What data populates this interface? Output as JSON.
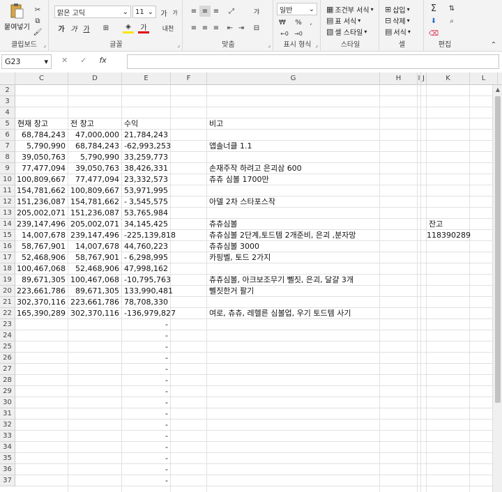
{
  "ribbon": {
    "clipboard": {
      "paste_label": "붙여넣기",
      "group_label": "클립보드"
    },
    "font": {
      "font_name": "맑은 고딕",
      "font_size": "11",
      "grow_label": "가",
      "shrink_label": "가",
      "bold_label": "가",
      "italic_label": "가",
      "underline_label": "가",
      "font_color_label": "가",
      "phonetic_label": "내천",
      "group_label": "글꼴"
    },
    "alignment": {
      "wrap_label": "갸",
      "group_label": "맞춤"
    },
    "number": {
      "format": "일반",
      "group_label": "표시 형식"
    },
    "styles": {
      "conditional_label": "조건부 서식",
      "table_label": "표 서식",
      "cell_style_label": "셀 스타일",
      "group_label": "스타일"
    },
    "cells": {
      "insert_label": "삽입",
      "delete_label": "삭제",
      "format_label": "서식",
      "group_label": "셀"
    },
    "editing": {
      "group_label": "편집"
    }
  },
  "formula_bar": {
    "name_box": "G23",
    "fx_label": "fx",
    "formula": ""
  },
  "columns": [
    "C",
    "D",
    "E",
    "F",
    "G",
    "H",
    "I",
    "J",
    "K",
    "L"
  ],
  "row_numbers": [
    "2",
    "3",
    "4",
    "5",
    "6",
    "7",
    "8",
    "9",
    "10",
    "11",
    "12",
    "13",
    "14",
    "15",
    "16",
    "17",
    "18",
    "19",
    "20",
    "21",
    "22",
    "23",
    "24",
    "25",
    "26",
    "27",
    "28",
    "29",
    "30",
    "31",
    "32",
    "33",
    "34",
    "35",
    "36",
    "37"
  ],
  "headers": {
    "current": "현재 창고",
    "previous": "전 창고",
    "profit": "수익",
    "notes": "비고",
    "balance": "잔고"
  },
  "balance_value": "118390289",
  "rows": [
    {
      "r": "6",
      "c": "68,784,243",
      "d": "47,000,000",
      "e_sign": "",
      "e": "21,784,243",
      "g": ""
    },
    {
      "r": "7",
      "c": "5,790,990",
      "d": "68,784,243",
      "e_sign": "-",
      "e": "62,993,253",
      "g": "앱솔너클 1.1"
    },
    {
      "r": "8",
      "c": "39,050,763",
      "d": "5,790,990",
      "e_sign": "",
      "e": "33,259,773",
      "g": ""
    },
    {
      "r": "9",
      "c": "77,477,094",
      "d": "39,050,763",
      "e_sign": "",
      "e": "38,426,331",
      "g": "손재주작 하려고 은괴삼 600"
    },
    {
      "r": "10",
      "c": "100,809,667",
      "d": "77,477,094",
      "e_sign": "",
      "e": "23,332,573",
      "g": "츄츄 심볼 1700만"
    },
    {
      "r": "11",
      "c": "154,781,662",
      "d": "100,809,667",
      "e_sign": "",
      "e": "53,971,995",
      "g": ""
    },
    {
      "r": "12",
      "c": "151,236,087",
      "d": "154,781,662",
      "e_sign": "-",
      "e": "3,545,575",
      "g": "아델 2차 스타포스작"
    },
    {
      "r": "13",
      "c": "205,002,071",
      "d": "151,236,087",
      "e_sign": "",
      "e": "53,765,984",
      "g": ""
    },
    {
      "r": "14",
      "c": "239,147,496",
      "d": "205,002,071",
      "e_sign": "",
      "e": "34,145,425",
      "g": "츄츄심볼"
    },
    {
      "r": "15",
      "c": "14,007,678",
      "d": "239,147,496",
      "e_sign": "-",
      "e": "225,139,818",
      "g": "츄츄심볼 2단계,토드템 2개준비, 은괴 ,분자망"
    },
    {
      "r": "16",
      "c": "58,767,901",
      "d": "14,007,678",
      "e_sign": "",
      "e": "44,760,223",
      "g": "츄츄심볼 3000"
    },
    {
      "r": "17",
      "c": "52,468,906",
      "d": "58,767,901",
      "e_sign": "-",
      "e": "6,298,995",
      "g": "카핑벨, 토드 2가지"
    },
    {
      "r": "18",
      "c": "100,467,068",
      "d": "52,468,906",
      "e_sign": "",
      "e": "47,998,162",
      "g": ""
    },
    {
      "r": "19",
      "c": "89,671,305",
      "d": "100,467,068",
      "e_sign": "-",
      "e": "10,795,763",
      "g": "츄츄심볼, 아크보조무기 뻴짓, 은괴, 달걀 3개"
    },
    {
      "r": "20",
      "c": "223,661,786",
      "d": "89,671,305",
      "e_sign": "",
      "e": "133,990,481",
      "g": "뻴짓한거 팔기"
    },
    {
      "r": "21",
      "c": "302,370,116",
      "d": "223,661,786",
      "e_sign": "",
      "e": "78,708,330",
      "g": ""
    },
    {
      "r": "22",
      "c": "165,390,289",
      "d": "302,370,116",
      "e_sign": "-",
      "e": "136,979,827",
      "g": "여로, 츄츄, 레헬른 심볼업, 우기 토드템 사기"
    }
  ],
  "dash_value": "-"
}
